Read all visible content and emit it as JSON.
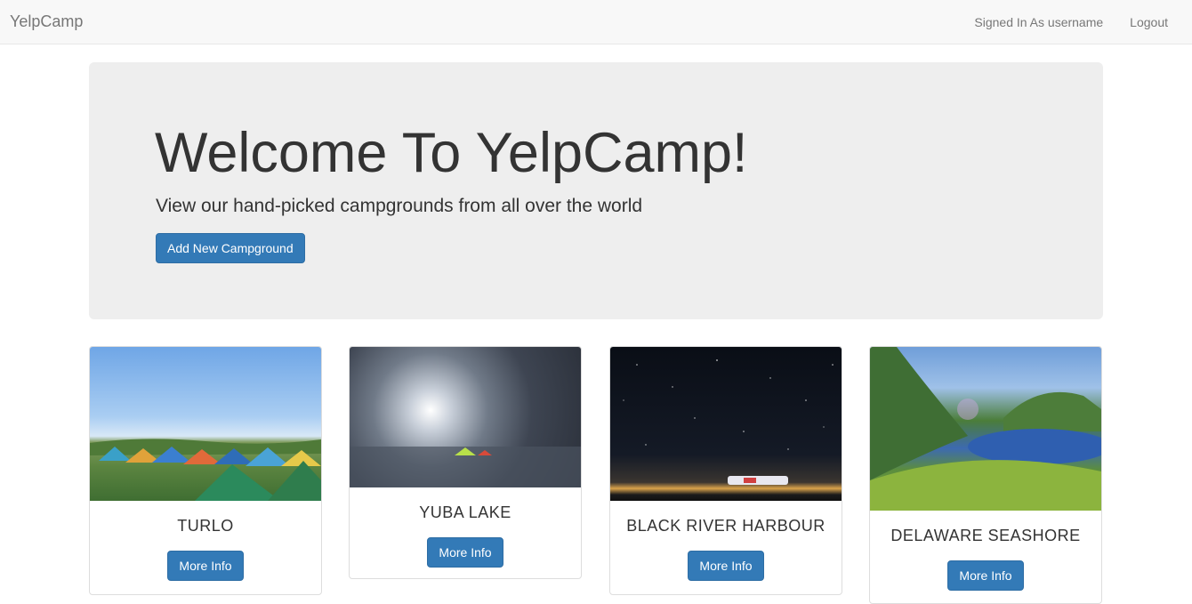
{
  "navbar": {
    "brand": "YelpCamp",
    "signed_in": "Signed In As username",
    "logout": "Logout"
  },
  "jumbotron": {
    "title": "Welcome To YelpCamp!",
    "subtitle": "View our hand-picked campgrounds from all over the world",
    "add_button": "Add New Campground"
  },
  "campgrounds": [
    {
      "name": "TURLO",
      "button": "More Info"
    },
    {
      "name": "YUBA LAKE",
      "button": "More Info"
    },
    {
      "name": "BLACK RIVER HARBOUR",
      "button": "More Info"
    },
    {
      "name": "DELAWARE SEASHORE",
      "button": "More Info"
    }
  ],
  "colors": {
    "primary": "#337ab7",
    "navbar_bg": "#f8f8f8",
    "jumbotron_bg": "#eeeeee"
  }
}
